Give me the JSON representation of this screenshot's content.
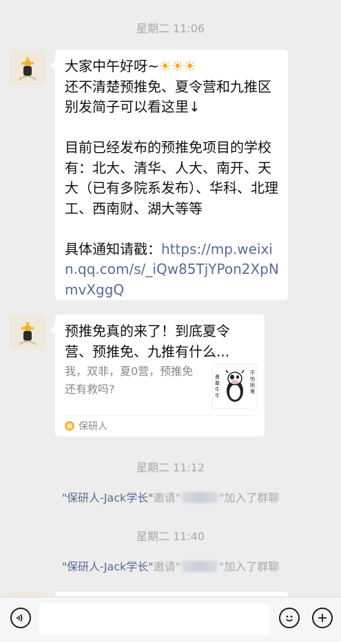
{
  "timestamps": {
    "first": "星期二 11:06",
    "second": "星期二 11:12",
    "third": "星期二 11:40"
  },
  "message1": {
    "line1": "大家中午好呀~",
    "line1_emoji": "☀☀☀",
    "paragraph1": "还不清楚预推免、夏令营和九推区别发简子可以看这里↓",
    "paragraph2": "目前已经发布的预推免项目的学校有：北大、清华、人大、南开、天大（已有多院系发布）、华科、北理工、西南财、湖大等等",
    "notice_label": "具体通知请戳：",
    "url": "https://mp.weixin.qq.com/s/_iQw85TjYPon2XpNmvXggQ"
  },
  "message2": {
    "card_title": "预推免真的来了！到底夏令营、预推免、九推有什么...",
    "card_desc": "我，双非，夏0营，预推免还有救吗?",
    "thumb_text_left": "勇敢牛牛",
    "thumb_text_right": "不怕困难",
    "source_name": "保研人"
  },
  "system1": {
    "inviter": "\"保研人-Jack学长\"",
    "invited": "邀请\"",
    "tail": "\"加入了群聊"
  },
  "system2": {
    "inviter": "\"保研人-Jack学长\"",
    "invited": "邀请\"",
    "tail": "\"加入了群聊"
  },
  "icons": {
    "voice": "voice-icon",
    "emoji": "emoji-icon",
    "more": "plus-icon"
  },
  "colors": {
    "background": "#ededed",
    "bubble": "#ffffff",
    "link": "#576b95",
    "timestamp": "#a8a8a8"
  }
}
